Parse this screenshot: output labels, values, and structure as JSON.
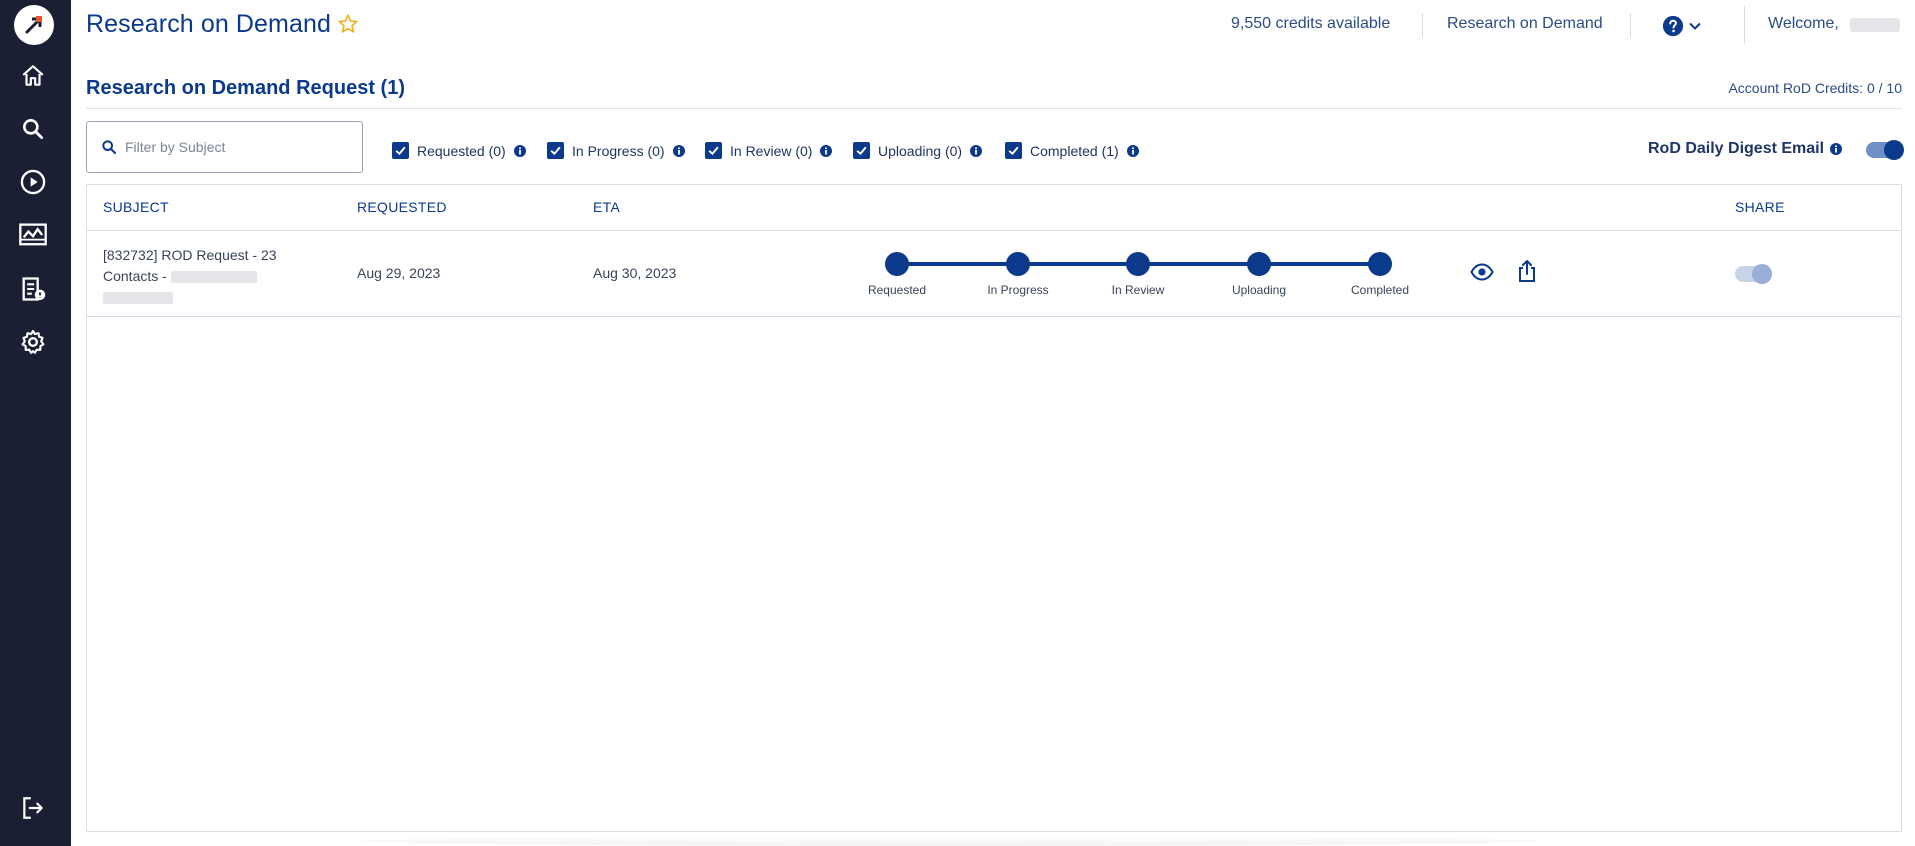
{
  "header": {
    "title": "Research on Demand",
    "credits": "9,550 credits available",
    "nav_link": "Research on Demand",
    "welcome": "Welcome,"
  },
  "section": {
    "title": "Research on Demand Request (1)",
    "account_credits": "Account RoD Credits: 0 / 10"
  },
  "filters": {
    "search_placeholder": "Filter by Subject",
    "statuses": [
      {
        "label": "Requested (0)",
        "checked": true
      },
      {
        "label": "In Progress (0)",
        "checked": true
      },
      {
        "label": "In Review (0)",
        "checked": true
      },
      {
        "label": "Uploading (0)",
        "checked": true
      },
      {
        "label": "Completed (1)",
        "checked": true
      }
    ],
    "digest_label": "RoD Daily Digest Email",
    "digest_enabled": true
  },
  "table": {
    "columns": [
      "SUBJECT",
      "REQUESTED",
      "ETA",
      "SHARE"
    ],
    "rows": [
      {
        "subject_line1": "[832732] ROD Request - 23",
        "subject_line2": "Contacts -",
        "requested": "Aug 29, 2023",
        "eta": "Aug 30, 2023",
        "steps": [
          "Requested",
          "In Progress",
          "In Review",
          "Uploading",
          "Completed"
        ],
        "current_step": "Completed",
        "shared": false
      }
    ]
  },
  "icons": {
    "sidebar": [
      "logo-icon",
      "home-icon",
      "search-icon",
      "play-icon",
      "chart-icon",
      "report-icon",
      "settings-icon",
      "logout-icon"
    ],
    "header": [
      "star-icon",
      "help-icon",
      "chevron-down-icon"
    ],
    "row": [
      "eye-icon",
      "share-icon"
    ]
  },
  "colors": {
    "primary": "#0b3a8c",
    "sidebar_bg": "#1a1f33",
    "accent_orange": "#e8552b",
    "star": "#f2b01e"
  }
}
